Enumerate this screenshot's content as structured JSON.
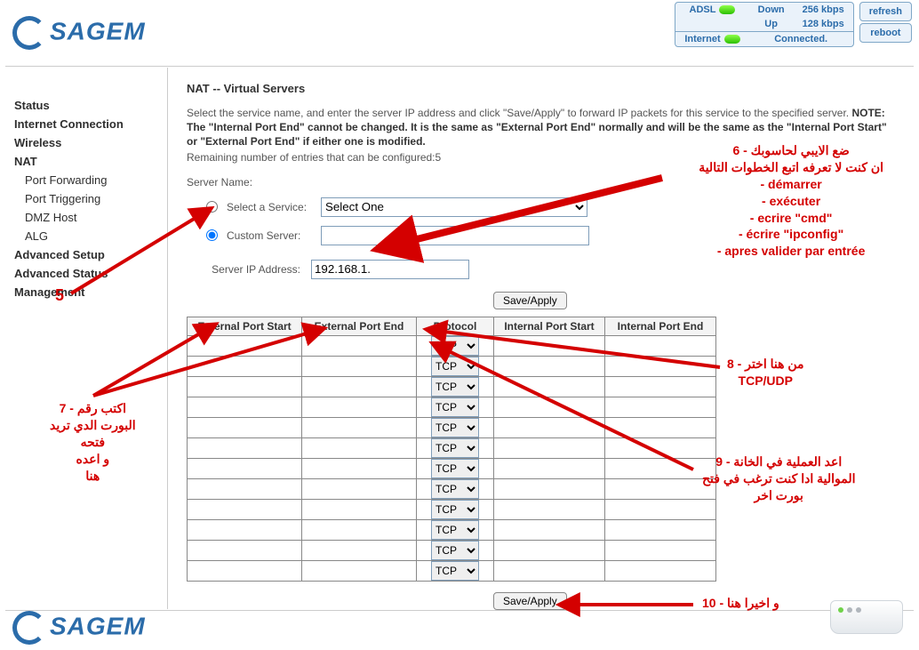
{
  "status": {
    "adsl_label": "ADSL",
    "internet_label": "Internet",
    "down_label": "Down",
    "up_label": "Up",
    "down_value": "256 kbps",
    "up_value": "128 kbps",
    "connected": "Connected."
  },
  "buttons": {
    "refresh": "refresh",
    "reboot": "reboot"
  },
  "logo": "SAGEM",
  "sidebar": {
    "status": "Status",
    "internet": "Internet Connection",
    "wireless": "Wireless",
    "nat": "NAT",
    "pf": "Port Forwarding",
    "pt": "Port Triggering",
    "dmz": "DMZ Host",
    "alg": "ALG",
    "adv_setup": "Advanced Setup",
    "adv_status": "Advanced Status",
    "mgmt": "Management"
  },
  "page": {
    "title": "NAT -- Virtual Servers",
    "desc1": "Select the service name, and enter the server IP address and click \"Save/Apply\" to forward IP packets for this service to the specified server. ",
    "note": "NOTE: The \"Internal Port End\" cannot be changed. It is the same as \"External Port End\" normally and will be the same as the \"Internal Port Start\" or \"External Port End\" if either one is modified.",
    "remain": "Remaining number of entries that can be configured:5",
    "server_name": "Server Name:",
    "select_service": "Select a Service:",
    "custom_server": "Custom Server:",
    "select_one": "Select One",
    "server_ip": "Server IP Address:",
    "ip_value": "192.168.1.",
    "save": "Save/Apply",
    "headers": {
      "eps": "External Port Start",
      "epe": "External Port End",
      "proto": "Protocol",
      "ips": "Internal Port Start",
      "ipe": "Internal Port End"
    },
    "proto_default": "TCP",
    "rows": 12
  },
  "anno": {
    "a5": "5",
    "a6_l1": "6 - ضع الايبي لحاسوبك",
    "a6_l2": "ان كنت لا تعرفه اتبع الخطوات التالية",
    "a6_l3": "- démarrer",
    "a6_l4": "- exécuter",
    "a6_l5": "- ecrire \"cmd\"",
    "a6_l6": "- écrire \"ipconfig\"",
    "a6_l7": "- apres valider par entrée",
    "a7_l1": "7 -  اكتب رقم",
    "a7_l2": "البورت الدي تريد",
    "a7_l3": "فتحه",
    "a7_l4": "و اعده",
    "a7_l5": "هنا",
    "a8_l1": "8 - من هنا اختر",
    "a8_l2": "TCP/UDP",
    "a9_l1": "9 - اعد العملية في الخانة",
    "a9_l2": "الموالية ادا كنت ترغب في فتح",
    "a9_l3": "بورت اخر",
    "a10": "10 - و اخيرا هنا"
  }
}
